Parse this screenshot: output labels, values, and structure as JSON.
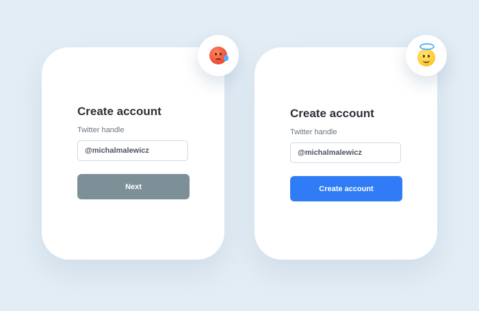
{
  "cards": [
    {
      "title": "Create account",
      "field_label": "Twitter handle",
      "input_value": "@michalmalewicz",
      "button_label": "Next",
      "button_color": "#7d9098",
      "emoji": "hot-face-sweat-emoji"
    },
    {
      "title": "Create account",
      "field_label": "Twitter handle",
      "input_value": "@michalmalewicz",
      "button_label": "Create account",
      "button_color": "#2f7cf6",
      "emoji": "smiling-halo-emoji"
    }
  ],
  "colors": {
    "background": "#e3edf5",
    "card": "#ffffff",
    "primary_blue": "#2f7cf6",
    "disabled_gray": "#7d9098"
  }
}
